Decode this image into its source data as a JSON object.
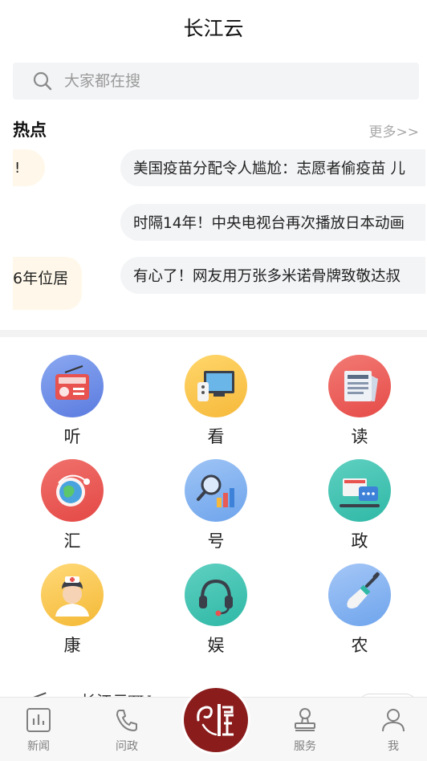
{
  "app": {
    "title": "长江云"
  },
  "search": {
    "placeholder": "大家都在搜"
  },
  "hot": {
    "title": "热点",
    "more": "更多>>",
    "left_fragments": [
      "!",
      "6年位居"
    ],
    "items": [
      "美国疫苗分配令人尴尬：志愿者偷疫苗 儿",
      "时隔14年！中央电视台再次播放日本动画",
      "有心了！网友用万张多米诺骨牌致敬达叔"
    ]
  },
  "features": [
    {
      "label": "听",
      "icon": "radio-icon"
    },
    {
      "label": "看",
      "icon": "tv-icon"
    },
    {
      "label": "读",
      "icon": "newspaper-icon"
    },
    {
      "label": "汇",
      "icon": "globe-icon"
    },
    {
      "label": "号",
      "icon": "search-chart-icon"
    },
    {
      "label": "政",
      "icon": "government-icon"
    },
    {
      "label": "康",
      "icon": "nurse-icon"
    },
    {
      "label": "娱",
      "icon": "headset-icon"
    },
    {
      "label": "农",
      "icon": "shovel-icon"
    }
  ],
  "peek": {
    "text": "长江云TV"
  },
  "tabs": [
    {
      "label": "新闻",
      "icon": "news-icon"
    },
    {
      "label": "问政",
      "icon": "phone-icon"
    },
    {
      "label": "",
      "icon": "center-logo-icon"
    },
    {
      "label": "服务",
      "icon": "stamp-icon"
    },
    {
      "label": "我",
      "icon": "user-icon"
    }
  ],
  "colors": {
    "accent": "#8a1c1c",
    "pill_bg": "#f3f4f6",
    "muted": "#9a9a9a"
  }
}
